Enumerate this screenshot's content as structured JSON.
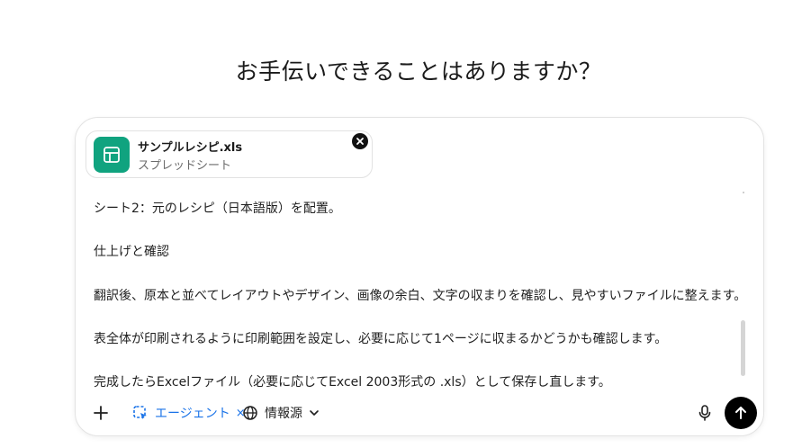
{
  "heading": "お手伝いできることはありますか？",
  "attachment": {
    "file_name": "サンプルレシピ.xls",
    "file_type": "スプレッドシート",
    "icon": "spreadsheet-icon",
    "icon_color": "#10a37f"
  },
  "input": {
    "lines": [
      "シート2：元のレシピ（日本語版）を配置。",
      "仕上げと確認",
      "翻訳後、原本と並べてレイアウトやデザイン、画像の余白、文字の収まりを確認し、見やすいファイルに整えます。",
      "表全体が印刷されるように印刷範囲を設定し、必要に応じて1ページに収まるかどうかも確認します。",
      "完成したらExcelファイル（必要に応じてExcel 2003形式の .xls）として保存し直します。"
    ]
  },
  "toolbar": {
    "agent_label": "エージェント",
    "agent_remove": "×",
    "sources_label": "情報源",
    "accent_color": "#1a73e8"
  }
}
